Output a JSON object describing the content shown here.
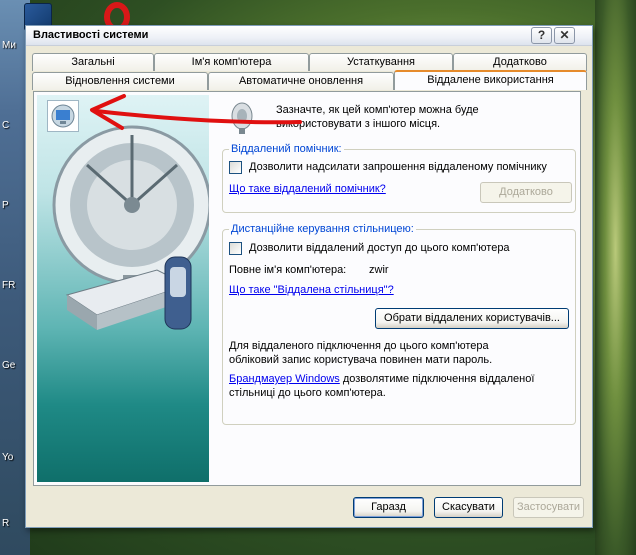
{
  "desktop": {
    "labels": [
      "Ми",
      "С",
      "Р",
      "FR",
      "Ge",
      "Yo",
      "R"
    ]
  },
  "window": {
    "title": "Властивості системи",
    "help_glyph": "?",
    "close_glyph": "✕"
  },
  "tabs": {
    "row1": [
      "Загальні",
      "Ім'я комп'ютера",
      "Устаткування",
      "Додатково"
    ],
    "row2": [
      "Відновлення системи",
      "Автоматичне оновлення",
      "Віддалене використання"
    ],
    "active": "Віддалене використання"
  },
  "intro": {
    "line1": "Зазначте, як цей комп'ютер можна буде",
    "line2": "використовувати з іншого місця."
  },
  "assistance": {
    "legend": "Віддалений помічник:",
    "checkbox_label": "Дозволити надсилати запрошення віддаленому помічнику",
    "checked": false,
    "link": "Що таке віддалений помічник?",
    "advanced_button": "Додатково"
  },
  "remote_desktop": {
    "legend": "Дистанційне керування стільницею:",
    "checkbox_label": "Дозволити віддалений доступ до цього комп'ютера",
    "checked": false,
    "full_name_label": "Повне ім'я комп'ютера:",
    "full_name_value": "zwir",
    "link": "Що таке \"Віддалена стільниця\"?",
    "select_users_button": "Обрати віддалених користувачів...",
    "note_line1": "Для віддаленого підключення до цього комп'ютера",
    "note_line2": "обліковий запис користувача повинен мати пароль.",
    "firewall_link": "Брандмауер Windows",
    "firewall_text_line1": " дозволятиме підключення віддаленої",
    "firewall_text_line2": "стільниці до цього комп'ютера."
  },
  "footer": {
    "ok": "Гаразд",
    "cancel": "Скасувати",
    "apply": "Застосувати"
  },
  "colors": {
    "accent_tab": "#e68b2c",
    "legend_blue": "#0046d5",
    "arrow_red": "#e01010"
  }
}
